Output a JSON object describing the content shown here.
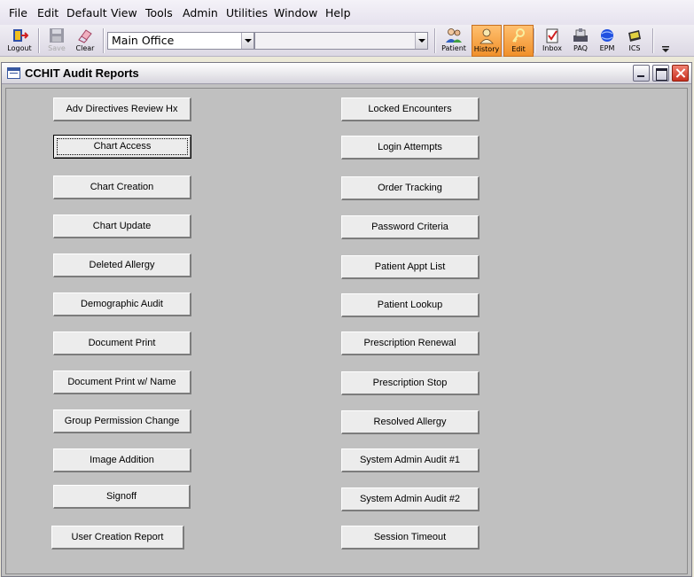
{
  "menu": [
    "File",
    "Edit",
    "Default",
    "View",
    "Tools",
    "Admin",
    "Utilities",
    "Window",
    "Help"
  ],
  "toolbar": {
    "logout": "Logout",
    "save": "Save",
    "clear": "Clear",
    "location": "Main Office",
    "secondary": "",
    "patient": "Patient",
    "history": "History",
    "edit": "Edit",
    "inbox": "Inbox",
    "paq": "PAQ",
    "epm": "EPM",
    "ics": "ICS"
  },
  "window": {
    "title": "CCHIT Audit Reports"
  },
  "reports": {
    "left": [
      "Adv Directives Review Hx",
      "Chart Access",
      "Chart Creation",
      "Chart Update",
      "Deleted Allergy",
      "Demographic Audit",
      "Document Print",
      "Document Print w/ Name",
      "Group Permission Change",
      "Image Addition",
      "Signoff",
      "User Creation Report"
    ],
    "right": [
      "Locked Encounters",
      "Login Attempts",
      "Order Tracking",
      "Password Criteria",
      "Patient Appt List",
      "Patient Lookup",
      "Prescription Renewal",
      "Prescription Stop",
      "Resolved Allergy",
      "System Admin Audit #1",
      "System Admin Audit #2",
      "Session Timeout"
    ]
  },
  "colors": {
    "accent_active": "#f0902a",
    "window_bg": "#c0c0c0",
    "close_button": "#c83020"
  }
}
